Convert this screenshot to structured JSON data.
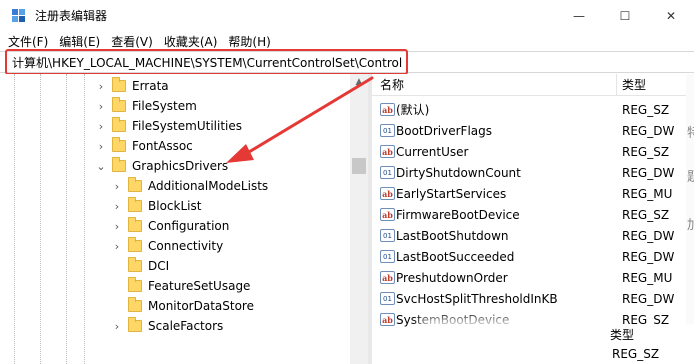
{
  "window": {
    "title": "注册表编辑器",
    "minimize": "—",
    "maximize": "☐",
    "close": "✕"
  },
  "menu": [
    "文件(F)",
    "编辑(E)",
    "查看(V)",
    "收藏夹(A)",
    "帮助(H)"
  ],
  "address": "计算机\\HKEY_LOCAL_MACHINE\\SYSTEM\\CurrentControlSet\\Control",
  "tree": {
    "items": [
      {
        "label": "Errata",
        "expand": "›"
      },
      {
        "label": "FileSystem",
        "expand": "›"
      },
      {
        "label": "FileSystemUtilities",
        "expand": "›"
      },
      {
        "label": "FontAssoc",
        "expand": "›"
      },
      {
        "label": "GraphicsDrivers",
        "expand": "⌄"
      },
      {
        "label": "AdditionalModeLists",
        "expand": "›"
      },
      {
        "label": "BlockList",
        "expand": "›"
      },
      {
        "label": "Configuration",
        "expand": "›"
      },
      {
        "label": "Connectivity",
        "expand": "›"
      },
      {
        "label": "DCI",
        "expand": ""
      },
      {
        "label": "FeatureSetUsage",
        "expand": ""
      },
      {
        "label": "MonitorDataStore",
        "expand": ""
      },
      {
        "label": "ScaleFactors",
        "expand": "›"
      }
    ],
    "scroll_up": "▲"
  },
  "values": {
    "header_name": "名称",
    "header_type": "类型",
    "rows": [
      {
        "icon": "ab",
        "name": "(默认)",
        "type": "REG_SZ"
      },
      {
        "icon": "bin",
        "name": "BootDriverFlags",
        "type": "REG_DW"
      },
      {
        "icon": "ab",
        "name": "CurrentUser",
        "type": "REG_SZ"
      },
      {
        "icon": "bin",
        "name": "DirtyShutdownCount",
        "type": "REG_DW"
      },
      {
        "icon": "ab",
        "name": "EarlyStartServices",
        "type": "REG_MU"
      },
      {
        "icon": "ab",
        "name": "FirmwareBootDevice",
        "type": "REG_SZ"
      },
      {
        "icon": "bin",
        "name": "LastBootShutdown",
        "type": "REG_DW"
      },
      {
        "icon": "bin",
        "name": "LastBootSucceeded",
        "type": "REG_DW"
      },
      {
        "icon": "ab",
        "name": "PreshutdownOrder",
        "type": "REG_MU"
      },
      {
        "icon": "bin",
        "name": "SvcHostSplitThresholdInKB",
        "type": "REG_DW"
      },
      {
        "icon": "ab",
        "name": "SystemBootDevice",
        "type": "REG_SZ"
      }
    ]
  },
  "overlay": {
    "type_label": "类型",
    "type_value": "REG_SZ"
  },
  "right_edge_chars": [
    "特",
    "题",
    "加"
  ],
  "colors": {
    "annotation": "#e53935",
    "folder": "#ffd766",
    "sz_icon": "#c0392b"
  },
  "icons": {
    "app": "registry-editor-icon",
    "folder": "folder-icon",
    "sz": "string-value-icon",
    "bin": "binary-value-icon"
  }
}
